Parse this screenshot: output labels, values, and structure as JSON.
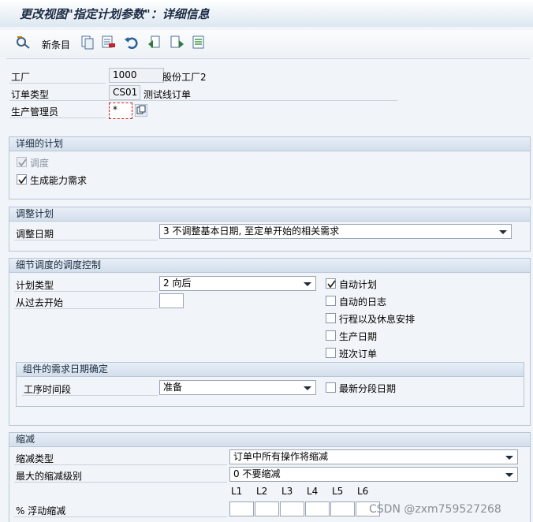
{
  "title": "更改视图\"指定计划参数\"：详细信息",
  "toolbar": {
    "new_entries_label": "新条目",
    "icons": [
      "display-change-icon",
      "copy-icon",
      "delete-icon",
      "undo-icon",
      "previous-entry-icon",
      "next-entry-icon",
      "select-all-icon"
    ]
  },
  "header": {
    "plant_label": "工厂",
    "plant_value": "1000",
    "plant_desc": "股份工厂2",
    "order_type_label": "订单类型",
    "order_type_value": "CS01",
    "order_type_desc": "测试线订单",
    "mrp_controller_label": "生产管理员",
    "mrp_controller_value": "*"
  },
  "detailed_planning": {
    "title": "详细的计划",
    "scheduling_label": "调度",
    "scheduling_checked": true,
    "capacity_req_label": "生成能力需求",
    "capacity_req_checked": true
  },
  "adjust_scheduling": {
    "title": "调整计划",
    "adjust_dates_label": "调整日期",
    "adjust_dates_value": "3 不调整基本日期, 至定单开始的相关需求"
  },
  "scheduling_control": {
    "title": "细节调度的调度控制",
    "sched_type_label": "计划类型",
    "sched_type_value": "2 向后",
    "start_past_label": "从过去开始",
    "start_past_value": "",
    "auto_schedule_label": "自动计划",
    "auto_schedule_checked": true,
    "auto_log_label": "自动的日志",
    "breaks_label": "行程以及休息安排",
    "prod_dates_label": "生产日期",
    "shift_order_label": "班次订单",
    "req_dates_title": "组件的需求日期确定",
    "op_segment_label": "工序时间段",
    "op_segment_value": "准备",
    "latest_staging_label": "最新分段日期"
  },
  "reduction": {
    "title": "缩减",
    "red_type_label": "缩减类型",
    "red_type_value": "订单中所有操作将缩减",
    "max_level_label": "最大的缩减级别",
    "max_level_value": "0 不要缩减",
    "levels": [
      "L1",
      "L2",
      "L3",
      "L4",
      "L5",
      "L6"
    ],
    "float_label": "% 浮动缩减"
  },
  "watermark": "CSDN @zxm759527268",
  "colors": {
    "title_text": "#1d2d44",
    "group_header": "#d3dfec",
    "focus_border": "#d9191e"
  }
}
